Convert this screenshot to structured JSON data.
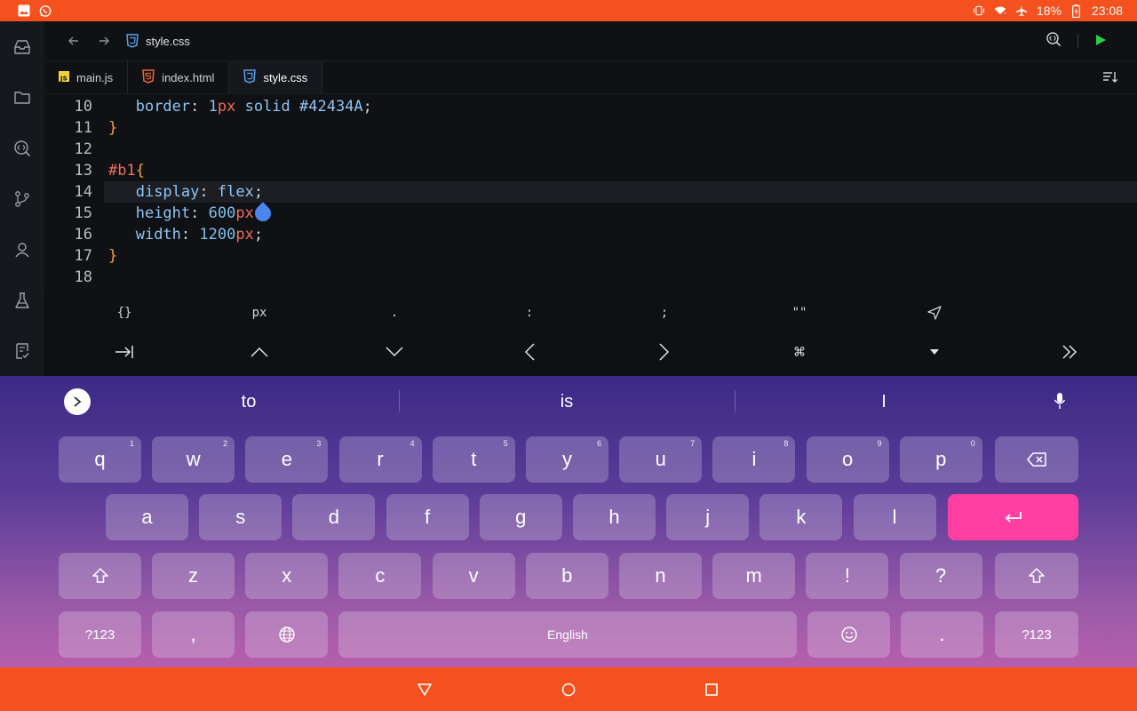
{
  "status_bar": {
    "battery": "18%",
    "time": "23:08",
    "left_icons": [
      "gallery-icon",
      "whatsapp-icon"
    ],
    "right_icons": [
      "vibrate-icon",
      "wifi-icon",
      "airplane-icon",
      "battery-charging-icon"
    ]
  },
  "activity_bar": {
    "items": [
      "inbox-icon",
      "folder-icon",
      "search-code-icon",
      "source-control-icon",
      "account-icon",
      "flask-icon",
      "tasks-icon"
    ]
  },
  "titlebar": {
    "file_name": "style.css"
  },
  "tabs": [
    {
      "label": "main.js",
      "icon": "js-icon",
      "active": false
    },
    {
      "label": "index.html",
      "icon": "html-icon",
      "active": false
    },
    {
      "label": "style.css",
      "icon": "css-icon",
      "active": true
    }
  ],
  "code": {
    "lines": [
      {
        "num": "10",
        "indent": true,
        "tokens": [
          [
            "prop",
            "border"
          ],
          [
            "punc",
            ": "
          ],
          [
            "num",
            "1"
          ],
          [
            "unit",
            "px"
          ],
          [
            "val",
            " solid "
          ],
          [
            "val",
            "#42434A"
          ],
          [
            "punc",
            ";"
          ]
        ]
      },
      {
        "num": "11",
        "indent": false,
        "tokens": [
          [
            "brace",
            "}"
          ]
        ]
      },
      {
        "num": "12",
        "indent": false,
        "tokens": []
      },
      {
        "num": "13",
        "indent": false,
        "tokens": [
          [
            "sel",
            "#b1"
          ],
          [
            "brace",
            "{"
          ]
        ]
      },
      {
        "num": "14",
        "indent": true,
        "tokens": [
          [
            "prop",
            "display"
          ],
          [
            "punc",
            ": "
          ],
          [
            "val",
            "flex"
          ],
          [
            "punc",
            ";"
          ]
        ]
      },
      {
        "num": "15",
        "indent": true,
        "tokens": [
          [
            "prop",
            "height"
          ],
          [
            "punc",
            ": "
          ],
          [
            "num",
            "600"
          ],
          [
            "unit",
            "px"
          ]
        ]
      },
      {
        "num": "16",
        "indent": true,
        "tokens": [
          [
            "prop",
            "width"
          ],
          [
            "punc",
            ": "
          ],
          [
            "num",
            "1200"
          ],
          [
            "unit",
            "px"
          ],
          [
            "punc",
            ";"
          ]
        ]
      },
      {
        "num": "17",
        "indent": false,
        "tokens": [
          [
            "brace",
            "}"
          ]
        ]
      },
      {
        "num": "18",
        "indent": false,
        "tokens": []
      }
    ],
    "current_line": "14"
  },
  "symbols_row": [
    "{}",
    "px",
    ".",
    ":",
    ";",
    "\"\"",
    "send-icon"
  ],
  "nav_row": [
    "tab-icon",
    "up-chevron-icon",
    "down-chevron-icon",
    "left-chevron-icon",
    "right-chevron-icon",
    "command-icon",
    "dropdown-icon",
    "more-icon"
  ],
  "keyboard": {
    "suggestions": [
      "to",
      "is",
      "I"
    ],
    "row1": [
      {
        "k": "q",
        "h": "1"
      },
      {
        "k": "w",
        "h": "2"
      },
      {
        "k": "e",
        "h": "3"
      },
      {
        "k": "r",
        "h": "4"
      },
      {
        "k": "t",
        "h": "5"
      },
      {
        "k": "y",
        "h": "6"
      },
      {
        "k": "u",
        "h": "7"
      },
      {
        "k": "i",
        "h": "8"
      },
      {
        "k": "o",
        "h": "9"
      },
      {
        "k": "p",
        "h": "0"
      }
    ],
    "row2": [
      "a",
      "s",
      "d",
      "f",
      "g",
      "h",
      "j",
      "k",
      "l"
    ],
    "row3": [
      "z",
      "x",
      "c",
      "v",
      "b",
      "n",
      "m",
      "!",
      "?"
    ],
    "symbols_key": "?123",
    "comma_key": ",",
    "space_label": "English",
    "period_key": ".",
    "accent_color": "#ff3fa2"
  },
  "colors": {
    "status_bar": "#f4511e",
    "nav_bar": "#f4511e",
    "editor_bg": "#101114",
    "selector": "#f06c5b",
    "brace": "#f0a63a",
    "property": "#8ec4f5"
  }
}
